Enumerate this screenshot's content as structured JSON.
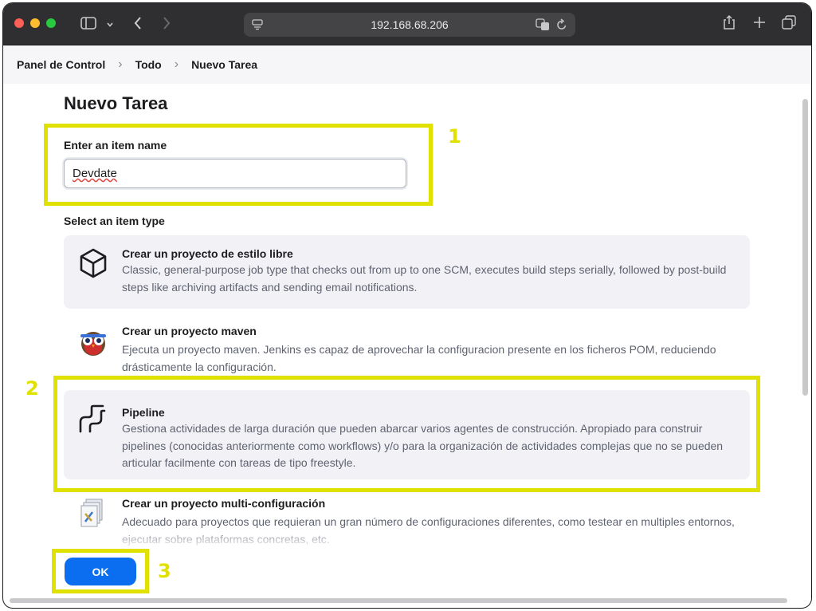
{
  "browser": {
    "url": "192.168.68.206"
  },
  "breadcrumb": [
    "Panel de Control",
    "Todo",
    "Nuevo Tarea"
  ],
  "page": {
    "title": "Nuevo Tarea",
    "name_label": "Enter an item name",
    "name_value": "Devdate",
    "type_label": "Select an item type"
  },
  "items": [
    {
      "title": "Crear un proyecto de estilo libre",
      "description": "Classic, general-purpose job type that checks out from up to one SCM, executes build steps serially, followed by post-build steps like archiving artifacts and sending email notifications.",
      "icon": "box-icon"
    },
    {
      "title": "Crear un proyecto maven",
      "description": "Ejecuta un proyecto maven. Jenkins es capaz de aprovechar la configuracion presente en los ficheros POM, reduciendo drásticamente la configuración.",
      "icon": "maven-owl-icon"
    },
    {
      "title": "Pipeline",
      "description": "Gestiona actividades de larga duración que pueden abarcar varios agentes de construcción. Apropiado para construir pipelines (conocidas anteriormente como workflows) y/o para la organización de actividades complejas que no se pueden articular facilmente con tareas de tipo freestyle.",
      "icon": "pipeline-icon"
    },
    {
      "title": "Crear un proyecto multi-configuración",
      "description": "Adecuado para proyectos que requieran un gran número de configuraciones diferentes, como testear en multiples entornos, ejecutar sobre plataformas concretas, etc.",
      "icon": "multi-config-icon"
    }
  ],
  "ok_label": "OK",
  "annotations": [
    "1",
    "2",
    "3"
  ],
  "colors": {
    "highlight": "#e1e100",
    "ok_button": "#0b6ef0"
  }
}
